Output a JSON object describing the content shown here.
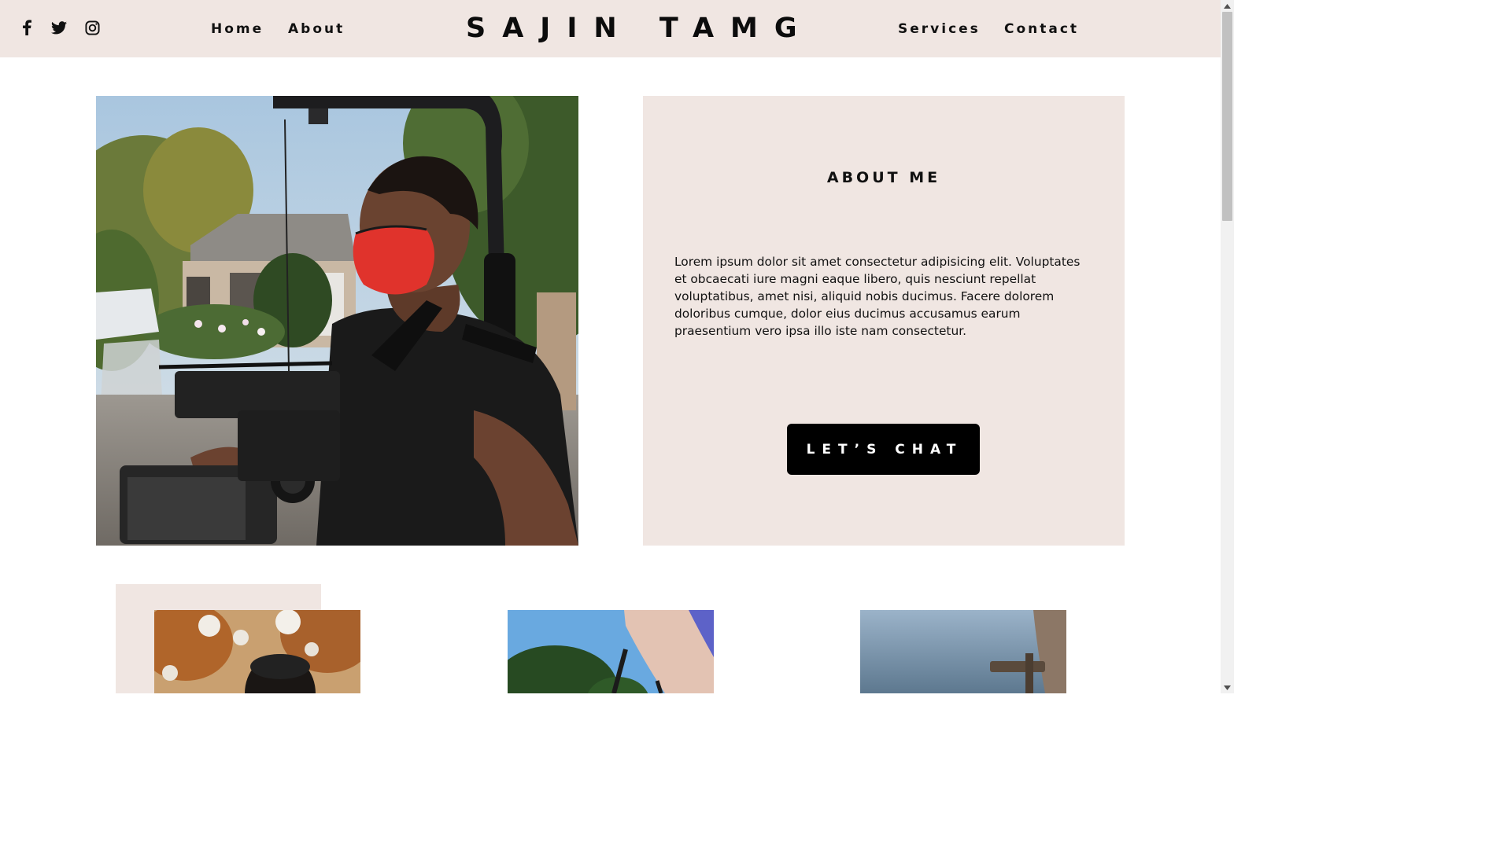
{
  "header": {
    "social": [
      {
        "name": "facebook-icon"
      },
      {
        "name": "twitter-icon"
      },
      {
        "name": "instagram-icon"
      }
    ],
    "nav_left": [
      "Home",
      "About"
    ],
    "logo": "SAJIN TAMG",
    "nav_right": [
      "Services",
      "Contact"
    ]
  },
  "about": {
    "title": "ABOUT ME",
    "body": "Lorem ipsum dolor sit amet consectetur adipisicing elit. Voluptates et obcaecati iure magni eaque libero, quis nesciunt repellat voluptatibus, amet nisi, aliquid nobis ducimus. Facere dolorem doloribus cumque, dolor eius ducimus accusamus earum praesentium vero ipsa illo iste nam consectetur.",
    "cta_label": "LET’S CHAT"
  },
  "colors": {
    "header_bg": "#f0e6e2",
    "panel_bg": "#f0e6e2",
    "button_bg": "#000000",
    "button_text": "#ffffff",
    "text": "#111111"
  },
  "hero_image": {
    "icon": "videographer-photo"
  },
  "gallery": [
    {
      "icon": "portrait-photo"
    },
    {
      "icon": "camera-rig-photo"
    },
    {
      "icon": "sky-equipment-photo"
    }
  ]
}
